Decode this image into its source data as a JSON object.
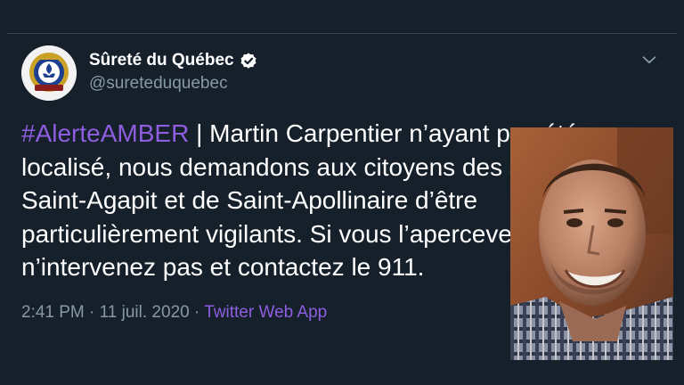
{
  "tweet": {
    "author_name": "Sûreté du Québec",
    "handle": "@sureteduquebec",
    "verified": true,
    "avatar_icon": "police-badge-icon",
    "hashtag": "#AlerteAMBER",
    "text_lines": [
      " | Martin Carpentier n’ayant pas été",
      "localisé, nous demandons aux citoyens des secteurs de",
      "Saint-Agapit et de Saint-Apollinaire d’être",
      "particulièrement vigilants. Si vous l’apercevez,",
      "n’intervenez pas et contactez le 911."
    ],
    "timestamp": "2:41 PM · 11 juil. 2020",
    "separator": " · ",
    "source": "Twitter Web App"
  },
  "overlay": {
    "photo": "man-portrait-photo"
  },
  "colors": {
    "background": "#15202b",
    "link_purple": "#8f5ee0",
    "secondary_text": "#8899a6",
    "verified_badge": "#ffffff"
  }
}
